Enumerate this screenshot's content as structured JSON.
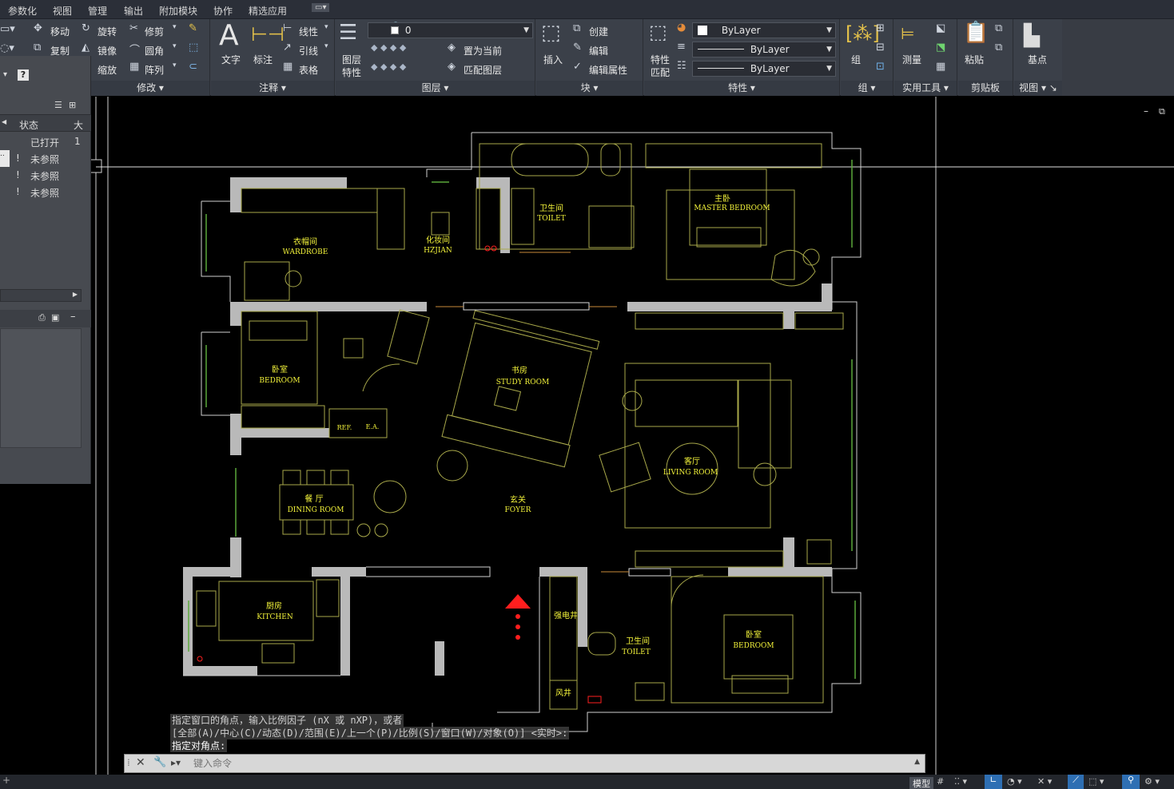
{
  "menu": [
    "参数化",
    "视图",
    "管理",
    "输出",
    "附加模块",
    "协作",
    "精选应用"
  ],
  "ribbon": {
    "modify": {
      "move": "移动",
      "rotate": "旋转",
      "trim": "修剪",
      "copy": "复制",
      "mirror": "镜像",
      "fillet": "圆角",
      "scale": "缩放",
      "array": "阵列",
      "label": "修改"
    },
    "annotation": {
      "text": "文字",
      "dim": "标注",
      "linear": "线性",
      "leader": "引线",
      "table": "表格",
      "label": "注释"
    },
    "layers": {
      "props1": "图层",
      "props2": "特性",
      "current": "0",
      "setcurrent": "置为当前",
      "match": "匹配图层",
      "label": "图层"
    },
    "block": {
      "insert": "插入",
      "create": "创建",
      "edit": "编辑",
      "editattr": "编辑属性",
      "label": "块"
    },
    "props": {
      "match1": "特性",
      "match2": "匹配",
      "color": "ByLayer",
      "linetype": "ByLayer",
      "lineweight": "ByLayer",
      "label": "特性"
    },
    "groups": {
      "group": "组",
      "label": "组"
    },
    "utilities": {
      "measure": "测量",
      "label": "实用工具"
    },
    "clipboard": {
      "paste": "粘贴",
      "label": "剪贴板"
    },
    "view": {
      "base": "基点",
      "label": "视图"
    }
  },
  "xref": {
    "col_status": "状态",
    "col_size": "大",
    "rows": [
      {
        "status": "已打开",
        "size": "1"
      },
      {
        "status": "未参照",
        "size": ""
      },
      {
        "status": "未参照",
        "size": ""
      },
      {
        "status": "未参照",
        "size": ""
      }
    ]
  },
  "rooms": {
    "wardrobe_cn": "衣帽间",
    "wardrobe_en": "WARDROBE",
    "hz_cn": "化妆间",
    "hz_en": "HZJIAN",
    "toilet1_cn": "卫生间",
    "toilet1_en": "TOILET",
    "master_cn": "主卧",
    "master_en": "MASTER BEDROOM",
    "bed1_cn": "卧室",
    "bed1_en": "BEDROOM",
    "study_cn": "书房",
    "study_en": "STUDY ROOM",
    "living_cn": "客厅",
    "living_en": "LIVING ROOM",
    "dining_cn": "餐  厅",
    "dining_en": "DINING ROOM",
    "foyer_cn": "玄关",
    "foyer_en": "FOYER",
    "kitchen_cn": "厨房",
    "kitchen_en": "KITCHEN",
    "shaft1": "强电井",
    "toilet2_cn": "卫生间",
    "toilet2_en": "TOILET",
    "bed2_cn": "卧室",
    "bed2_en": "BEDROOM",
    "shaft2": "风井",
    "ref": "REF.",
    "ea": "E.A."
  },
  "command": {
    "line1": "指定窗口的角点，输入比例因子 (nX 或 nXP)，或者",
    "line2": "[全部(A)/中心(C)/动态(D)/范围(E)/上一个(P)/比例(S)/窗口(W)/对象(O)] <实时>:",
    "line3": "指定对角点:",
    "placeholder": "键入命令"
  },
  "status": {
    "model": "模型",
    "grid": "栅"
  }
}
